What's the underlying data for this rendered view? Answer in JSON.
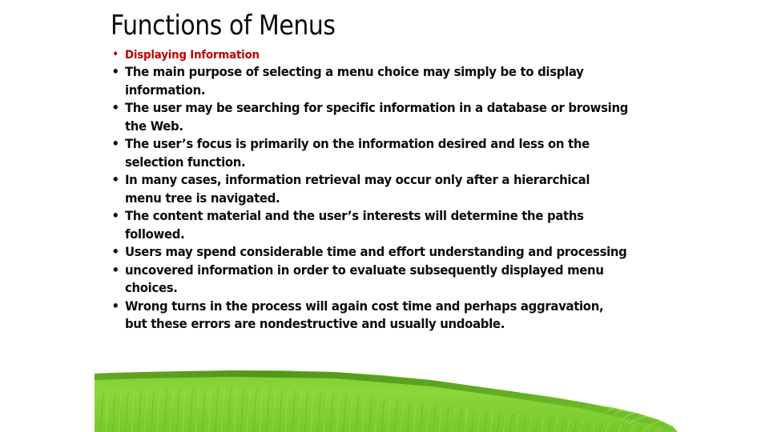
{
  "slide": {
    "title": "Functions of Menus",
    "bullets": [
      {
        "id": "displaying-information",
        "text": "Displaying Information",
        "style": "accent"
      },
      {
        "id": "main-purpose",
        "text": "The main purpose of selecting a menu choice may simply be to display information.",
        "style": "normal"
      },
      {
        "id": "searching-database",
        "text": "The user may be searching for specific information in a database or browsing the Web.",
        "style": "normal"
      },
      {
        "id": "user-focus",
        "text": "The user’s focus is primarily on the information desired and less on the selection function.",
        "style": "normal"
      },
      {
        "id": "hierarchical-retrieval",
        "text": "In many cases, information retrieval may occur only after a hierarchical menu tree is navigated.",
        "style": "normal"
      },
      {
        "id": "content-material",
        "text": "The content material and the user’s interests will determine the paths followed.",
        "style": "normal"
      },
      {
        "id": "time-and-effort",
        "text": "Users may spend considerable time and effort understanding and processing",
        "style": "normal"
      },
      {
        "id": "uncovered-information",
        "text": "uncovered information in order to evaluate subsequently displayed menu choices.",
        "style": "normal"
      },
      {
        "id": "wrong-turns",
        "text": "Wrong turns in the process will again cost time and perhaps aggravation, but these errors are nondestructive and usually undoable.",
        "style": "normal"
      }
    ],
    "bullet_glyph": "•"
  },
  "decoration": {
    "grass_image_name": "grass-field-image",
    "colors": {
      "grass_light": "#8ed63c",
      "grass_mid": "#76c82a",
      "grass_dark": "#4e8f1c",
      "grass_crest_dark": "#3f7a18",
      "grass_highlight": "#a7e05a"
    }
  },
  "theme": {
    "background": "#ffffff",
    "title_color": "#0d0d0d",
    "body_color": "#0d0d0d",
    "accent_color": "#c00000"
  }
}
